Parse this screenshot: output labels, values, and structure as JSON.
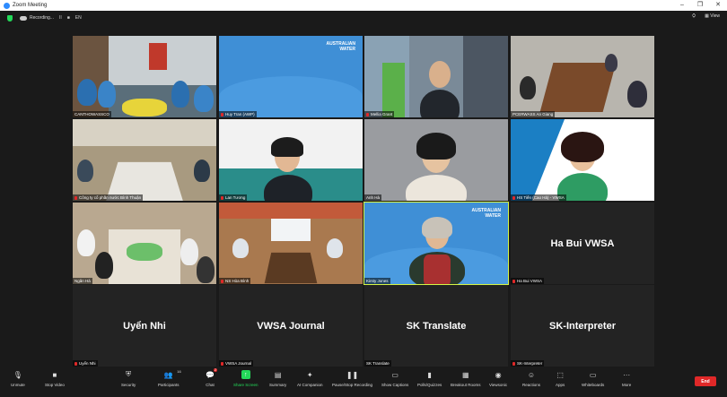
{
  "window": {
    "title": "Zoom Meeting",
    "controls": [
      "–",
      "❐",
      "✕"
    ]
  },
  "topbar": {
    "recording_label": "Recording...",
    "pause": "II",
    "stop": "■",
    "language": "EN",
    "view_label": "View"
  },
  "tiles": [
    {
      "name": "CANTHOWASSCO",
      "muted": false,
      "kind": "video"
    },
    {
      "name": "Huy Tran (AWP)",
      "muted": true,
      "kind": "video"
    },
    {
      "name": "Mellia Grant",
      "muted": true,
      "kind": "video"
    },
    {
      "name": "PCERWASS An Giang",
      "muted": false,
      "kind": "video"
    },
    {
      "name": "Công ty cổ phần nước Bình Thuận",
      "muted": true,
      "kind": "video"
    },
    {
      "name": "Lan Tương",
      "muted": true,
      "kind": "video"
    },
    {
      "name": "Anh Hà",
      "muted": false,
      "kind": "video"
    },
    {
      "name": "HS Tiến (Cao Hà) - VWSA",
      "muted": true,
      "kind": "video"
    },
    {
      "name": "Ngân Hà",
      "muted": false,
      "kind": "video"
    },
    {
      "name": "NS Hòa Bình",
      "muted": true,
      "kind": "video"
    },
    {
      "name": "Kirsty Jones",
      "muted": false,
      "kind": "video",
      "active": true
    },
    {
      "name": "Ha Bui VWSA",
      "muted": true,
      "kind": "avatar"
    },
    {
      "name": "Uyển Nhi",
      "muted": true,
      "kind": "avatar"
    },
    {
      "name": "VWSA Journal",
      "muted": true,
      "kind": "avatar"
    },
    {
      "name": "SK Translate",
      "muted": false,
      "kind": "avatar"
    },
    {
      "name": "SK-Interpreter",
      "muted": true,
      "kind": "avatar"
    }
  ],
  "branding": {
    "aw_line1": "AUSTRALIAN",
    "aw_line2": "WATER"
  },
  "toolbar": {
    "unmute": "Unmute",
    "stop_video": "Stop Video",
    "security": "Security",
    "participants": "Participants",
    "participants_count": "16",
    "chat": "Chat",
    "chat_badge": "2",
    "share_screen": "Share Screen",
    "summary": "Summary",
    "ai_companion": "AI Companion",
    "pause_recording": "Pause/Stop Recording",
    "captions": "Show Captions",
    "polls": "Polls/Quizzes",
    "breakout": "Breakout Rooms",
    "viewsonic": "Viewsonic",
    "reactions": "Reactions",
    "apps": "Apps",
    "whiteboards": "Whiteboards",
    "more": "More",
    "end": "End"
  },
  "colors": {
    "accent": "#2d8cff",
    "share": "#23d959",
    "end": "#e02828",
    "active_border": "#d6f545"
  }
}
